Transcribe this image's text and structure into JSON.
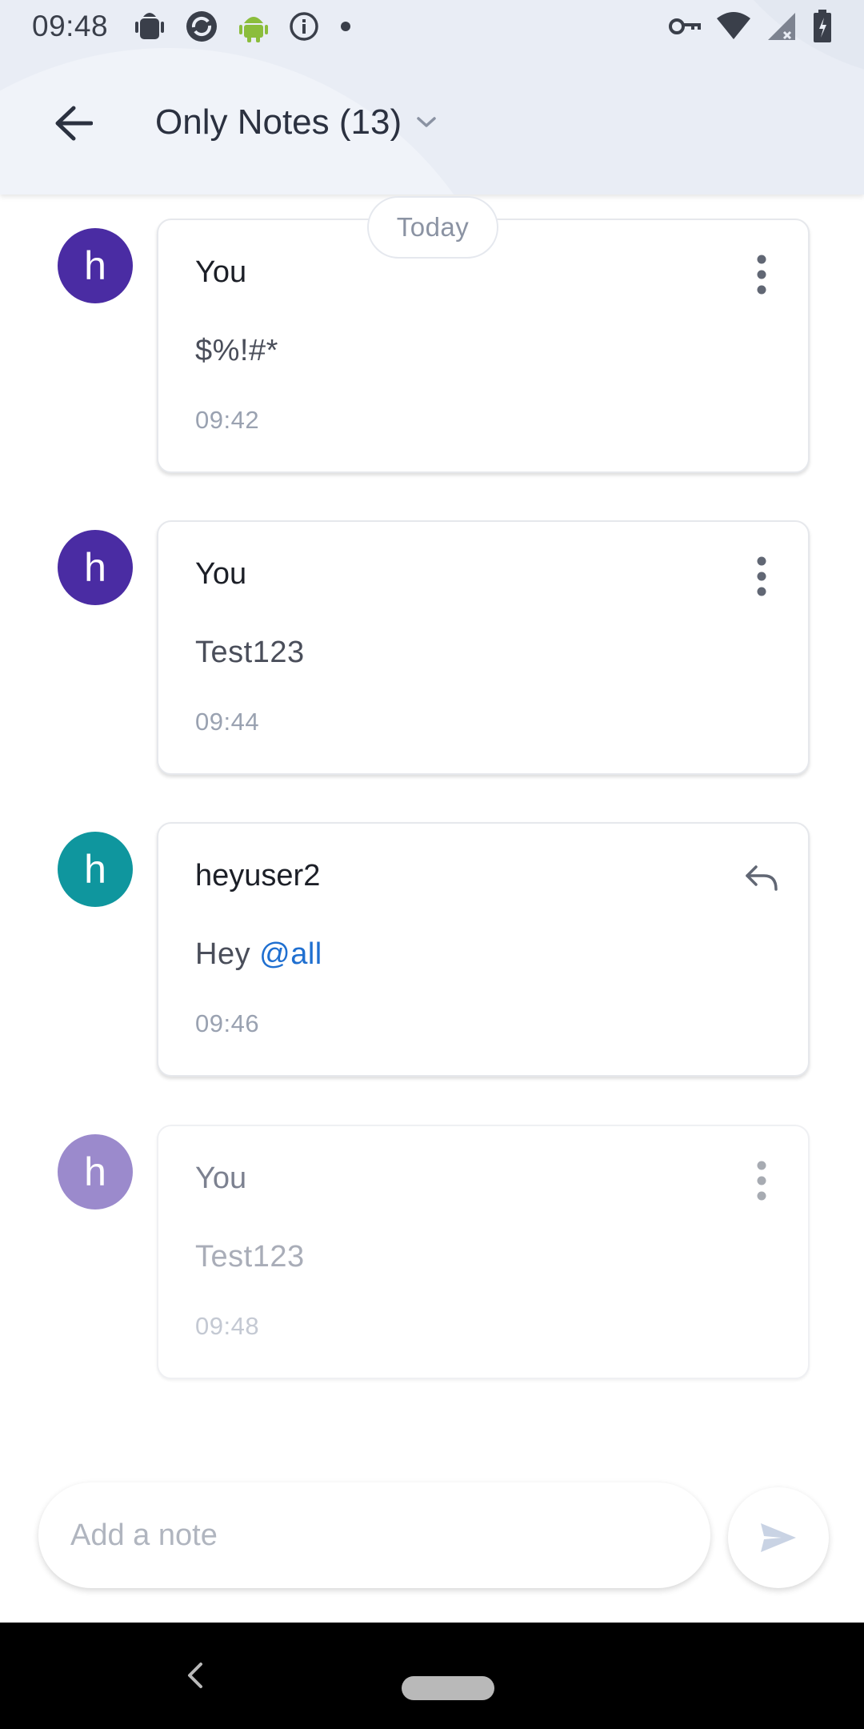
{
  "status_bar": {
    "time": "09:48",
    "left_icons": [
      "android-debug-icon",
      "sync-icon",
      "android-icon",
      "info-icon",
      "dot-icon"
    ],
    "right_icons": [
      "vpn-key-icon",
      "wifi-icon",
      "signal-icon",
      "battery-icon"
    ]
  },
  "header": {
    "title": "Only Notes (13)",
    "back_icon": "arrow-back-icon",
    "dropdown_icon": "chevron-down-icon"
  },
  "date_separator": "Today",
  "notes": [
    {
      "avatar_letter": "h",
      "avatar_color": "#4a2ca3",
      "author": "You",
      "body": "$%!#*",
      "time": "09:42",
      "action_icon": "more-vert-icon"
    },
    {
      "avatar_letter": "h",
      "avatar_color": "#4a2ca3",
      "author": "You",
      "body": "Test123",
      "time": "09:44",
      "action_icon": "more-vert-icon"
    },
    {
      "avatar_letter": "h",
      "avatar_color": "#0f969e",
      "author": "heyuser2",
      "body_prefix": "Hey ",
      "body_mention": "@all",
      "time": "09:46",
      "action_icon": "reply-icon"
    },
    {
      "avatar_letter": "h",
      "avatar_color": "#4a2ca3",
      "author": "You",
      "body": "Test123",
      "time": "09:48",
      "action_icon": "more-vert-icon",
      "pending": true
    }
  ],
  "composer": {
    "placeholder": "Add a note",
    "send_icon": "send-icon"
  },
  "nav_bar": {
    "back_icon": "nav-back-icon",
    "home_icon": "home-pill-icon"
  },
  "colors": {
    "accent": "#1f6fd0",
    "header_bg": "#e9edf5"
  }
}
